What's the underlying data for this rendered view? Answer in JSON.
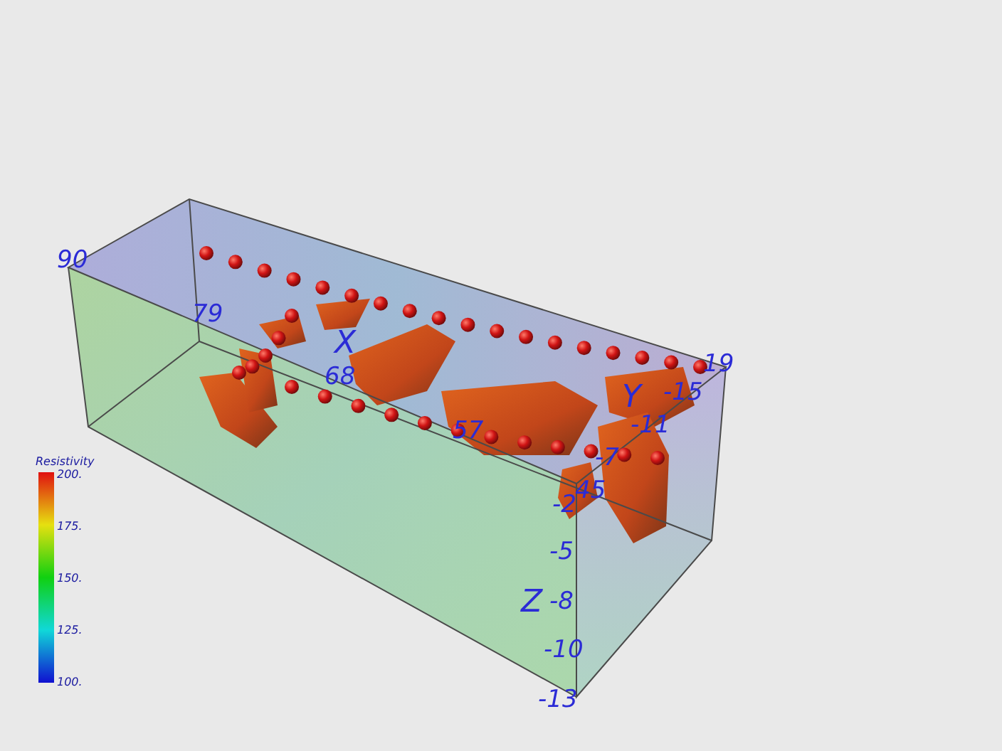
{
  "scene": {
    "x_axis": {
      "title": "X",
      "ticks": [
        "90",
        "79",
        "68",
        "57",
        "45"
      ]
    },
    "y_axis": {
      "title": "Y",
      "ticks": [
        "19",
        "-15",
        "-11",
        "-7"
      ]
    },
    "z_axis": {
      "title": "Z",
      "ticks": [
        "-2",
        "-5",
        "-8",
        "-10",
        "-13"
      ]
    }
  },
  "colorbar": {
    "title": "Resistivity",
    "ticks": [
      "200.",
      "175.",
      "150.",
      "125.",
      "100."
    ]
  }
}
